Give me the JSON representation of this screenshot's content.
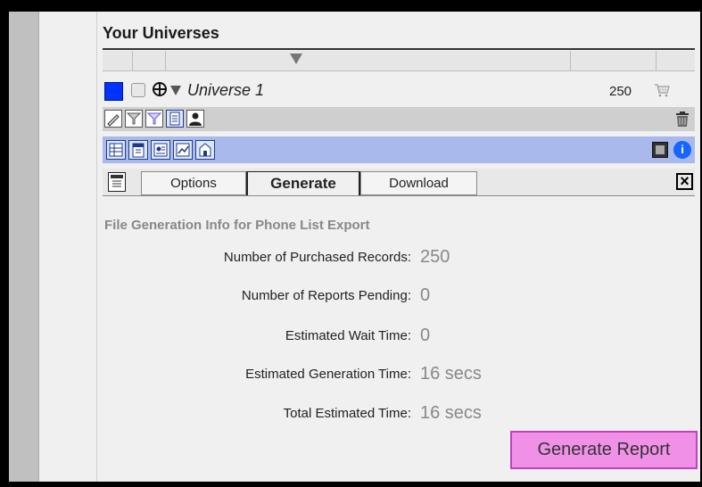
{
  "panel": {
    "title": "Your Universes"
  },
  "universe": {
    "color": "#0033ff",
    "name": "Universe 1",
    "count": "250"
  },
  "toolbar": {
    "icons": [
      "pencil-icon",
      "filter-icon",
      "filter-check-icon",
      "list-icon",
      "person-icon",
      "trash-icon"
    ]
  },
  "report_types": {
    "icons": [
      "report-table-icon",
      "report-phone-icon",
      "report-contact-icon",
      "report-chart-icon",
      "report-building-icon",
      "film-icon",
      "info-icon"
    ]
  },
  "tabs": {
    "options": "Options",
    "generate": "Generate",
    "download": "Download"
  },
  "generate": {
    "heading": "File Generation Info for Phone List Export",
    "rows": [
      {
        "label": "Number of Purchased Records:",
        "value": "250"
      },
      {
        "label": "Number of Reports Pending:",
        "value": "0"
      },
      {
        "label": "Estimated Wait Time:",
        "value": "0"
      },
      {
        "label": "Estimated Generation Time:",
        "value": "16 secs"
      },
      {
        "label": "Total Estimated Time:",
        "value": "16 secs"
      }
    ],
    "button_label": "Generate Report"
  }
}
